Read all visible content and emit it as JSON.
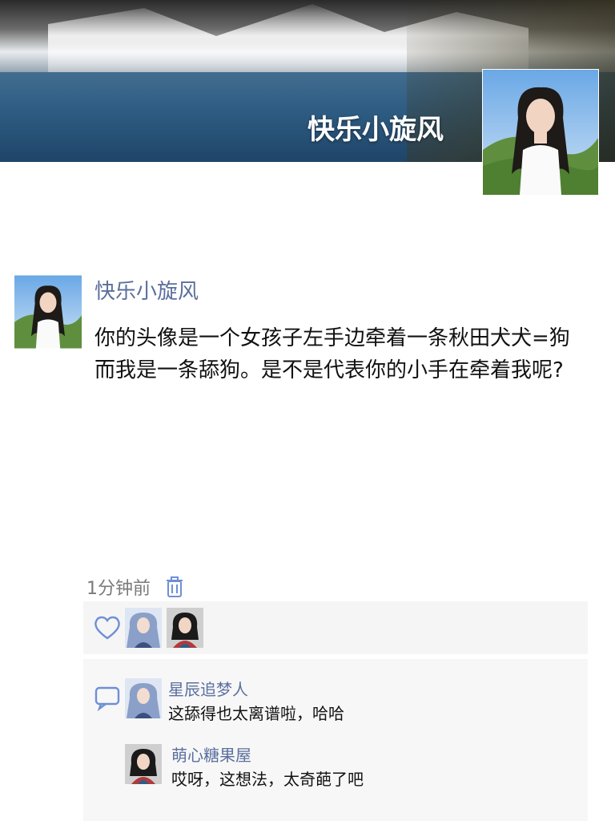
{
  "profile": {
    "name": "快乐小旋风"
  },
  "post": {
    "author": "快乐小旋风",
    "text": "你的头像是一个女孩子左手边牵着一条秋田犬犬=狗而我是一条舔狗。是不是代表你的小手在牵着我呢?",
    "time": "1分钟前"
  },
  "icons": {
    "delete": "trash-icon",
    "like": "heart-icon",
    "comment": "comment-bubble-icon"
  },
  "likes": {
    "count_avatars": 2
  },
  "comments": [
    {
      "user": "星辰追梦人",
      "text": "这舔得也太离谱啦，哈哈"
    },
    {
      "user": "萌心糖果屋",
      "text": "哎呀，这想法，太奇葩了吧"
    }
  ],
  "colors": {
    "name_blue": "#5b6f9e",
    "panel_bg": "#f5f5f5",
    "accent_blue": "#6f8fd6"
  }
}
